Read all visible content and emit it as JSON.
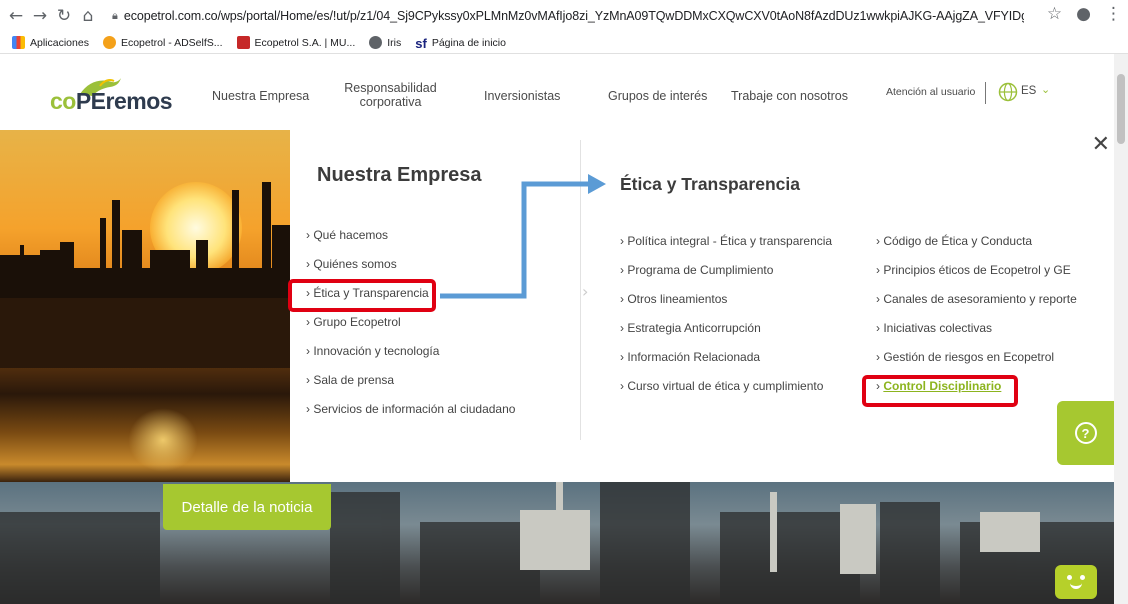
{
  "browser": {
    "url_host": "ecopetrol.com.co",
    "url_rest": "/wps/portal/Home/es/!ut/p/z1/04_Sj9CPykssy0xPLMnMz0vMAfIjo8zi_YzMnA09TQwDDMxCXQwCXV0tAoN8fAzdDUz1wwkpiAJKG-AAjgZA_VFYIDgaOAUZO...",
    "bookmarks": [
      {
        "label": "Aplicaciones",
        "icon": "apps-grid-icon"
      },
      {
        "label": "Ecopetrol - ADSelfS...",
        "icon": "ecopetrol-favicon-icon"
      },
      {
        "label": "Ecopetrol S.A. | MU...",
        "icon": "mu-favicon-icon"
      },
      {
        "label": "Iris",
        "icon": "globe-icon"
      },
      {
        "label": "Página de inicio",
        "icon": "sf-favicon-icon"
      }
    ]
  },
  "header": {
    "logo_co": "co",
    "logo_rest": "PEremos",
    "nav": [
      "Nuestra Empresa",
      "Responsabilidad corporativa",
      "Inversionistas",
      "Grupos de interés",
      "Trabaje con nosotros"
    ],
    "attention": "Atención al usuario",
    "lang": "ES"
  },
  "menu": {
    "title": "Nuestra Empresa",
    "left_items": [
      "› Qué hacemos",
      "› Quiénes somos",
      "› Ética y Transparencia",
      "› Grupo Ecopetrol",
      "› Innovación y tecnología",
      "› Sala de prensa",
      "› Servicios de información al ciudadano"
    ],
    "sub_title": "Ética y Transparencia",
    "col1": [
      "› Política integral - Ética y transparencia",
      "› Programa de Cumplimiento",
      "› Otros lineamientos",
      "› Estrategia Anticorrupción",
      "› Información Relacionada",
      "› Curso virtual de ética y cumplimiento"
    ],
    "col2": [
      "› Código de Ética y Conducta",
      "› Principios éticos de Ecopetrol y GE",
      "› Canales de asesoramiento y reporte",
      "› Iniciativas colectivas",
      "› Gestión de riesgos en Ecopetrol"
    ],
    "col2_highlight_prefix": "› ",
    "col2_highlight": "Control Disciplinario",
    "close": "✕"
  },
  "news_button": "Detalle de la noticia",
  "help_symbol": "?",
  "colors": {
    "brand_green": "#a6c830",
    "annotation_red": "#e00012",
    "arrow_blue": "#5b9bd5"
  }
}
